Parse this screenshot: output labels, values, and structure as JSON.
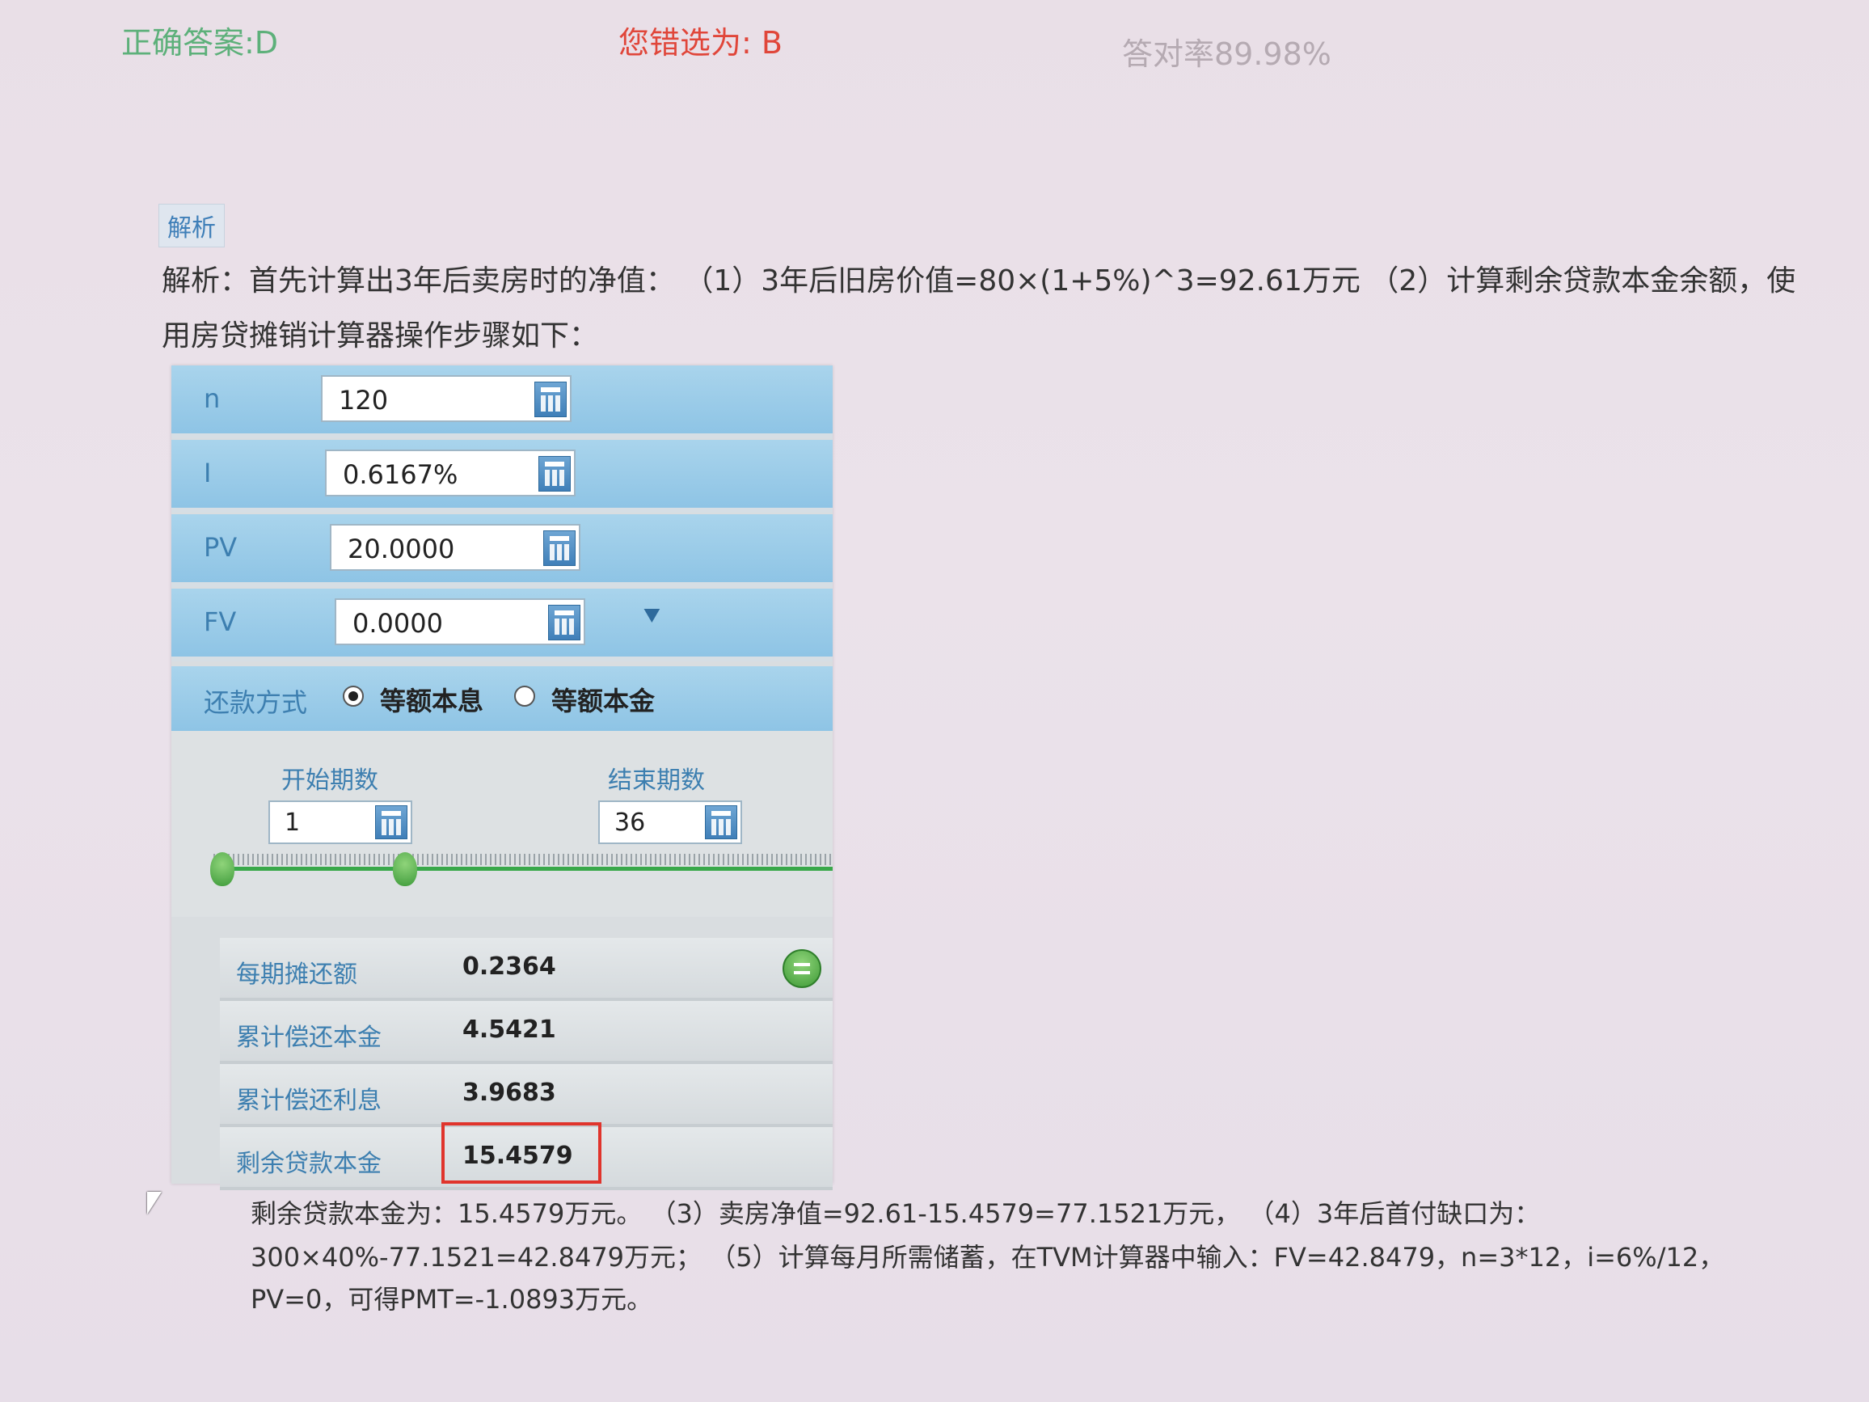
{
  "result": {
    "correct_answer": "正确答案:D",
    "your_choice": "您错选为: B",
    "accuracy": "答对率89.98%"
  },
  "analysis": {
    "tag": "解析",
    "line1": "解析：首先计算出3年后卖房时的净值： （1）3年后旧房价值=80×(1+5%)^3=92.61万元 （2）计算剩余贷款本金余额，使",
    "line2": "用房贷摊销计算器操作步骤如下："
  },
  "calculator": {
    "fields": [
      {
        "label": "n",
        "value": "120"
      },
      {
        "label": "I",
        "value": "0.6167%"
      },
      {
        "label": "PV",
        "value": "20.0000"
      },
      {
        "label": "FV",
        "value": "0.0000"
      }
    ],
    "expand_icon": "double-chevron-down-icon",
    "payment_method": {
      "label": "还款方式",
      "options": [
        "等额本息",
        "等额本金"
      ],
      "selected": "等额本息"
    },
    "start_period": {
      "label": "开始期数",
      "value": "1"
    },
    "end_period": {
      "label": "结束期数",
      "value": "36"
    },
    "results": [
      {
        "label": "每期摊还额",
        "value": "0.2364"
      },
      {
        "label": "累计偿还本金",
        "value": "4.5421"
      },
      {
        "label": "累计偿还利息",
        "value": "3.9683"
      },
      {
        "label": "剩余贷款本金",
        "value": "15.4579"
      }
    ],
    "colors": {
      "highlight": "#e0342c",
      "accent": "#3d7fb0",
      "slider": "#39a84a"
    }
  },
  "conclusion": {
    "line1": "剩余贷款本金为：15.4579万元。 （3）卖房净值=92.61-15.4579=77.1521万元， （4）3年后首付缺口为：",
    "line2": "300×40%-77.1521=42.8479万元； （5）计算每月所需储蓄，在TVM计算器中输入：FV=42.8479，n=3*12，i=6%/12，",
    "line3": "PV=0，可得PMT=-1.0893万元。"
  }
}
